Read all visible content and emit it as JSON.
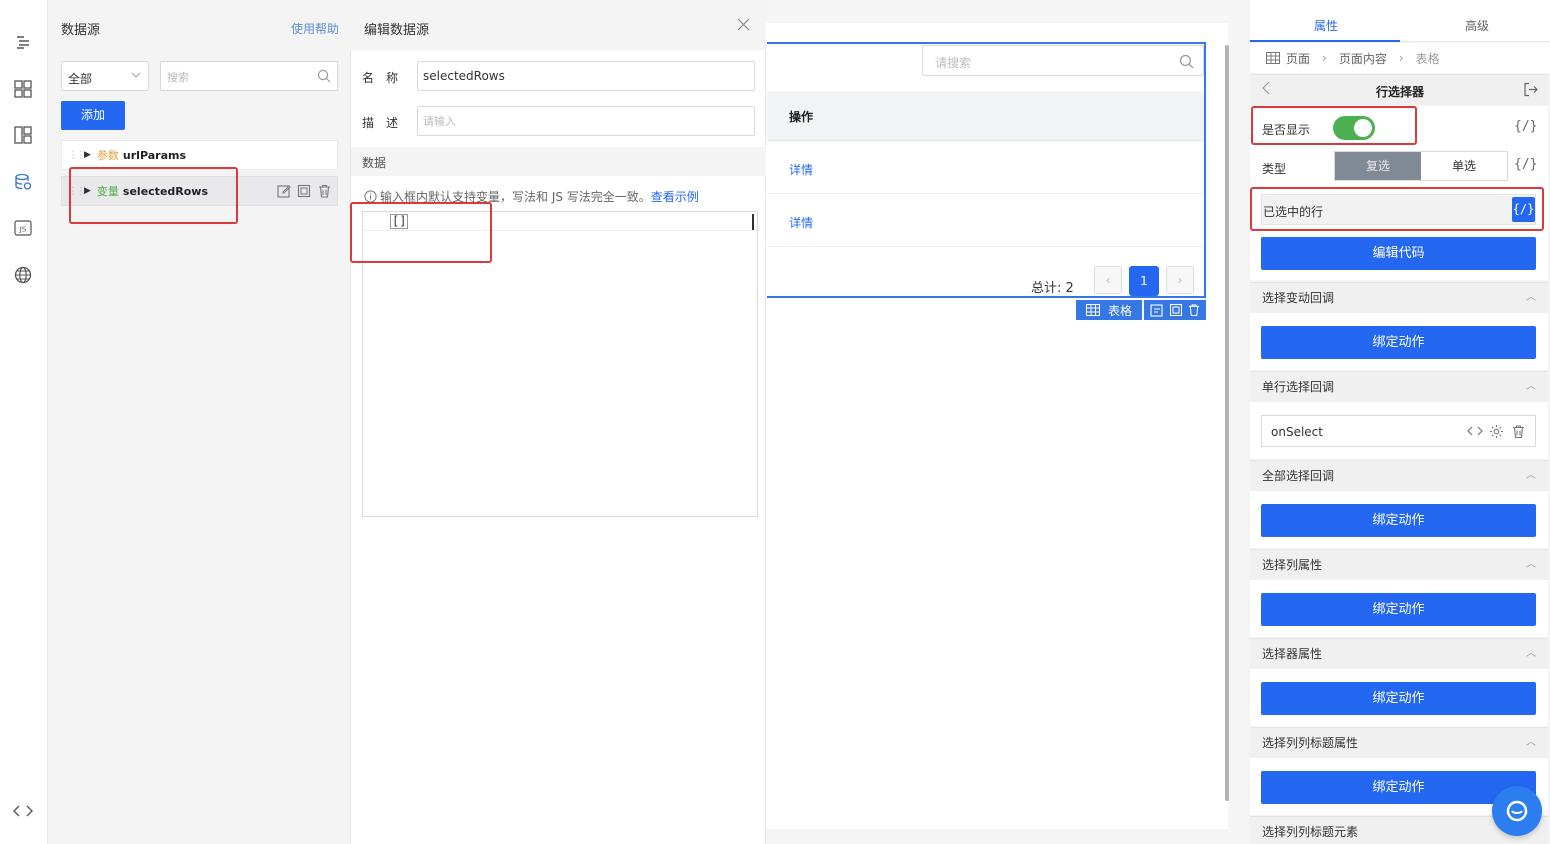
{
  "left_rail": {
    "icons": [
      "outline-icon",
      "components-icon",
      "layout-icon",
      "datasource-icon",
      "js-icon",
      "globe-icon",
      "code-icon"
    ]
  },
  "datasource_panel": {
    "title": "数据源",
    "help_link": "使用帮助",
    "filter_value": "全部",
    "search_placeholder": "搜索",
    "add_button": "添加",
    "items": [
      {
        "tag": "参数",
        "name": "urlParams"
      },
      {
        "tag": "变量",
        "name": "selectedRows"
      }
    ]
  },
  "edit_panel": {
    "title": "编辑数据源",
    "name_label": "名　称",
    "name_value": "selectedRows",
    "desc_label": "描　述",
    "desc_placeholder": "请输入",
    "data_section": "数据",
    "hint_text": "输入框内默认支持变量，写法和 JS 写法完全一致。",
    "hint_link": "查看示例",
    "code_value": "[]"
  },
  "canvas": {
    "search_placeholder": "请搜索",
    "column_header": "操作",
    "rows": [
      "详情",
      "详情"
    ],
    "total_label": "总计: 2",
    "current_page": "1",
    "component_badge": "表格"
  },
  "properties_panel": {
    "tabs": [
      "属性",
      "高级"
    ],
    "active_tab": "属性",
    "breadcrumb": [
      "页面",
      "页面内容",
      "表格"
    ],
    "section_title": "行选择器",
    "show_label": "是否显示",
    "show_enabled": true,
    "type_label": "类型",
    "type_options": [
      "复选",
      "单选"
    ],
    "type_selected": "复选",
    "selected_rows_label": "已选中的行",
    "edit_code_button": "编辑代码",
    "fx_symbol": "{/}",
    "sections": [
      {
        "title": "选择变动回调",
        "button": "绑定动作"
      },
      {
        "title": "单行选择回调",
        "event": "onSelect"
      },
      {
        "title": "全部选择回调",
        "button": "绑定动作"
      },
      {
        "title": "选择列属性",
        "button": "绑定动作"
      },
      {
        "title": "选择器属性",
        "button": "绑定动作"
      },
      {
        "title": "选择列列标题属性",
        "button": "绑定动作"
      },
      {
        "title": "选择列列标题元素"
      }
    ],
    "accent_color": "#2468f2",
    "toggle_color": "#4caf50"
  }
}
